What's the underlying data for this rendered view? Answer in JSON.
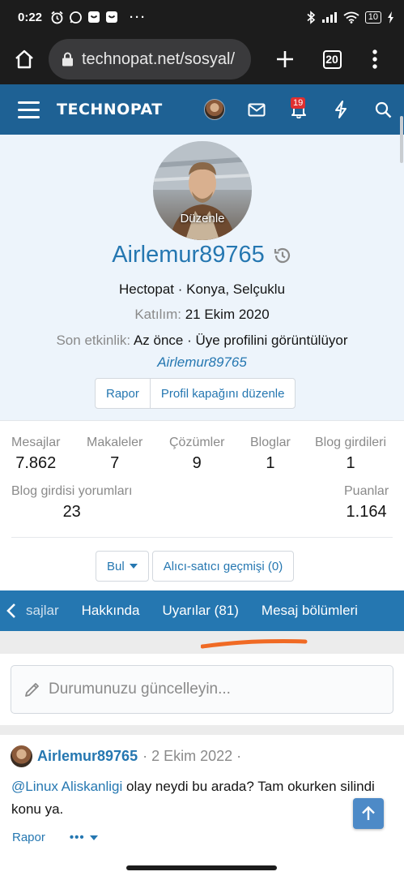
{
  "status_bar": {
    "time": "0:22",
    "battery": "10"
  },
  "browser": {
    "url": "technopat.net/sosyal/",
    "tab_count": "20"
  },
  "site": {
    "logo": "TECHNOPAT",
    "notification_count": "19"
  },
  "profile": {
    "avatar_edit": "Düzenle",
    "username": "Airlemur89765",
    "title_location": "Hectopat · Konya, Selçuklu",
    "joined_label": "Katılım:",
    "joined_value": "21 Ekim 2020",
    "last_activity_label": "Son etkinlik:",
    "last_activity_value": "Az önce · Üye profilini görüntülüyor",
    "viewing_user": "Airlemur89765",
    "report_button": "Rapor",
    "edit_cover_button": "Profil kapağını düzenle"
  },
  "stats": {
    "messages_label": "Mesajlar",
    "messages": "7.862",
    "articles_label": "Makaleler",
    "articles": "7",
    "solutions_label": "Çözümler",
    "solutions": "9",
    "blogs_label": "Bloglar",
    "blogs": "1",
    "blog_entries_label": "Blog girdileri",
    "blog_entries": "1",
    "blog_comments_label": "Blog girdisi yorumları",
    "blog_comments": "23",
    "points_label": "Puanlar",
    "points": "1.164",
    "find_button": "Bul",
    "trade_history_button": "Alıcı-satıcı geçmişi (0)"
  },
  "tabs": {
    "items": [
      "sajlar",
      "Hakkında",
      "Uyarılar (81)",
      "Mesaj bölümleri"
    ]
  },
  "status_update": {
    "placeholder": "Durumunuzu güncelleyin..."
  },
  "post": {
    "author": "Airlemur89765",
    "date": "· 2 Ekim 2022 ·",
    "mention": "@Linux Aliskanligi",
    "text": " olay neydi bu arada? Tam okurken silindi konu ya.",
    "report": "Rapor",
    "more": "•••"
  },
  "colors": {
    "header": "#1e6194",
    "accent": "#2577b1",
    "annotation": "#f06a24"
  }
}
